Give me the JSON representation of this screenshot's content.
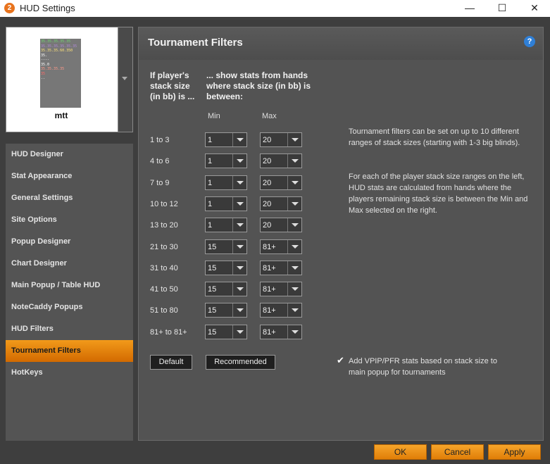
{
  "window": {
    "title": "HUD Settings",
    "minimize": "—",
    "maximize": "☐",
    "close": "✕",
    "app_icon": "2"
  },
  "preview": {
    "name": "mtt",
    "hud_lines": [
      {
        "text": "35.35.35.35.35",
        "color": "#6fd86f"
      },
      {
        "text": "35.35.35.35.35.35",
        "color": "#b28bd8"
      },
      {
        "text": "35.35.35.60.350",
        "color": "#ffe37a"
      },
      {
        "text": "35.",
        "color": "#ffffff"
      },
      {
        "text": "----",
        "color": "#ffffff"
      },
      {
        "text": "",
        "color": "#ffffff"
      },
      {
        "text": "35.0",
        "color": "#ffffff"
      },
      {
        "text": "",
        "color": "#ffffff"
      },
      {
        "text": "35.35.35.35",
        "color": "#ff9a8a"
      },
      {
        "text": "",
        "color": "#ffffff"
      },
      {
        "text": "35",
        "color": "#ff6a6a"
      },
      {
        "text": "",
        "color": "#ffffff"
      },
      {
        "text": "..",
        "color": "#ffffff"
      }
    ]
  },
  "sidebar": {
    "items": [
      {
        "label": "HUD Designer",
        "active": false
      },
      {
        "label": "Stat Appearance",
        "active": false
      },
      {
        "label": "General Settings",
        "active": false
      },
      {
        "label": "Site Options",
        "active": false
      },
      {
        "label": "Popup Designer",
        "active": false
      },
      {
        "label": "Chart Designer",
        "active": false
      },
      {
        "label": "Main Popup / Table HUD",
        "active": false
      },
      {
        "label": "NoteCaddy Popups",
        "active": false
      },
      {
        "label": "HUD Filters",
        "active": false
      },
      {
        "label": "Tournament Filters",
        "active": true
      },
      {
        "label": "HotKeys",
        "active": false
      }
    ]
  },
  "panel": {
    "title": "Tournament Filters",
    "help_icon": "?",
    "col1_header": [
      "If player's",
      "stack size",
      "(in bb) is ..."
    ],
    "col2_header": [
      "... show stats from hands",
      "where stack size (in bb) is",
      "between:"
    ],
    "min_label": "Min",
    "max_label": "Max",
    "rows": [
      {
        "range": "1 to 3",
        "min": "1",
        "max": "20"
      },
      {
        "range": "4 to 6",
        "min": "1",
        "max": "20"
      },
      {
        "range": "7 to 9",
        "min": "1",
        "max": "20"
      },
      {
        "range": "10 to 12",
        "min": "1",
        "max": "20"
      },
      {
        "range": "13 to 20",
        "min": "1",
        "max": "20"
      },
      {
        "range": "21 to 30",
        "min": "15",
        "max": "81+"
      },
      {
        "range": "31 to 40",
        "min": "15",
        "max": "81+"
      },
      {
        "range": "41 to 50",
        "min": "15",
        "max": "81+"
      },
      {
        "range": "51 to 80",
        "min": "15",
        "max": "81+"
      },
      {
        "range": "81+ to 81+",
        "min": "15",
        "max": "81+"
      }
    ],
    "info1": "Tournament filters can be set on up to 10 different ranges of stack sizes (starting with 1-3 big blinds).",
    "info2": "For each of the player stack size ranges on the left, HUD stats are calculated from hands where the players remaining stack size is between the Min and Max selected on the right.",
    "default_label": "Default",
    "recommended_label": "Recommended",
    "checkbox_checked": true,
    "checkbox_mark": "✔",
    "checkbox_label": "Add VPIP/PFR stats based on stack size to main popup for tournaments"
  },
  "footer": {
    "ok": "OK",
    "cancel": "Cancel",
    "apply": "Apply"
  }
}
